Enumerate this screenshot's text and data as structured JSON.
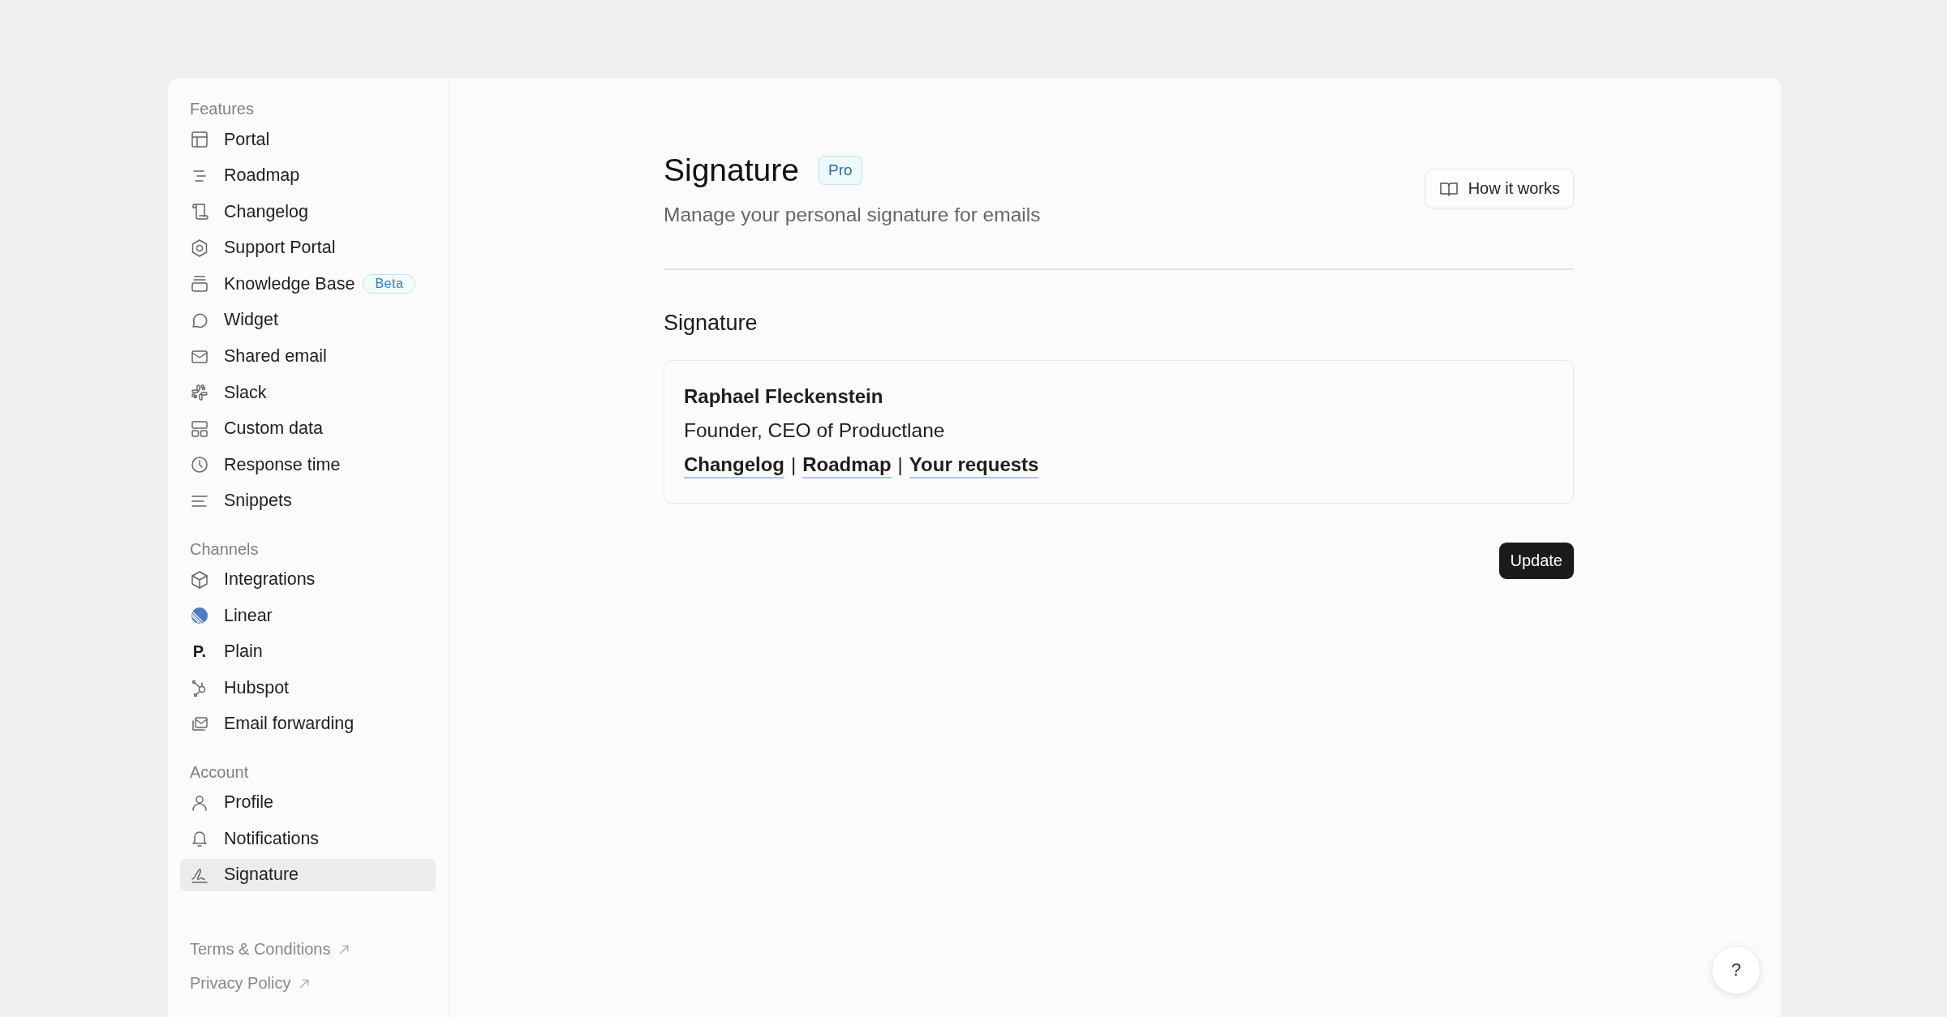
{
  "sidebar": {
    "groups": [
      {
        "heading": "Features",
        "items": [
          {
            "label": "Portal",
            "selected": false
          },
          {
            "label": "Roadmap",
            "selected": false
          },
          {
            "label": "Changelog",
            "selected": false
          },
          {
            "label": "Support Portal",
            "selected": false
          },
          {
            "label": "Knowledge Base",
            "selected": false,
            "badge": "Beta"
          },
          {
            "label": "Widget",
            "selected": false
          },
          {
            "label": "Shared email",
            "selected": false
          },
          {
            "label": "Slack",
            "selected": false
          },
          {
            "label": "Custom data",
            "selected": false
          },
          {
            "label": "Response time",
            "selected": false
          },
          {
            "label": "Snippets",
            "selected": false
          }
        ]
      },
      {
        "heading": "Channels",
        "items": [
          {
            "label": "Integrations",
            "selected": false
          },
          {
            "label": "Linear",
            "selected": false
          },
          {
            "label": "Plain",
            "selected": false,
            "icon_text": "P."
          },
          {
            "label": "Hubspot",
            "selected": false
          },
          {
            "label": "Email forwarding",
            "selected": false
          }
        ]
      },
      {
        "heading": "Account",
        "items": [
          {
            "label": "Profile",
            "selected": false
          },
          {
            "label": "Notifications",
            "selected": false
          },
          {
            "label": "Signature",
            "selected": true
          }
        ]
      }
    ],
    "footer_links": [
      "Terms & Conditions",
      "Privacy Policy"
    ]
  },
  "header": {
    "title": "Signature",
    "badge": "Pro",
    "subtitle": "Manage your personal signature for emails",
    "help_button": "How it works"
  },
  "section": {
    "title": "Signature",
    "signature": {
      "name": "Raphael Fleckenstein",
      "role": "Founder, CEO of Productlane",
      "links": [
        "Changelog",
        "Roadmap",
        "Your requests"
      ],
      "separator": "|"
    }
  },
  "update_button": "Update",
  "help_fab": "?"
}
